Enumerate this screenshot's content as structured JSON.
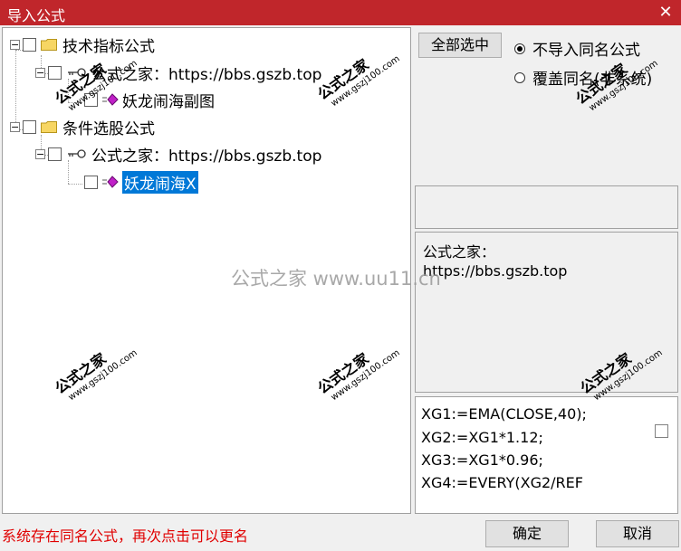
{
  "window": {
    "title": "导入公式",
    "close_glyph": "✕"
  },
  "tree": {
    "node_tech": "技术指标公式",
    "node_tech_sub": "公式之家：https://bbs.gszb.top",
    "node_tech_formula": "妖龙闹海副图",
    "node_select": "条件选股公式",
    "node_select_sub": "公式之家：https://bbs.gszb.top",
    "node_select_formula": "妖龙闹海X",
    "expander_glyph": "−"
  },
  "options": {
    "select_all": "全部选中",
    "radio_no_import": "不导入同名公式",
    "radio_overwrite": "覆盖同名(非系统)",
    "selected": "no_import"
  },
  "description": {
    "line1": "公式之家：",
    "line2": "https://bbs.gszb.top"
  },
  "code": {
    "lines": [
      "XG1:=EMA(CLOSE,40);",
      "XG2:=XG1*1.12;",
      "XG3:=XG1*0.96;",
      "XG4:=EVERY(XG2/REF"
    ]
  },
  "status": "系统存在同名公式，再次点击可以更名",
  "buttons": {
    "ok": "确定",
    "cancel": "取消"
  },
  "watermark": {
    "center": "公式之家 www.uu11.cn",
    "stamp_name": "公式之家",
    "stamp_url": "www.gszj100.com"
  },
  "colors": {
    "titlebar": "#c0262b",
    "selection": "#0078d7",
    "status": "#e00000"
  }
}
